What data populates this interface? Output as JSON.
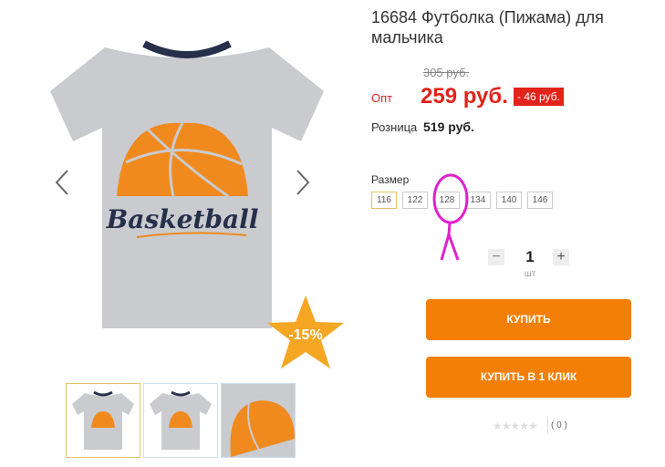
{
  "product": {
    "title": "16684 Футболка (Пижама) для мальчика",
    "old_price": "305 руб.",
    "opt_label": "Опт",
    "price": "259 руб.",
    "discount": "- 46 руб.",
    "retail_label": "Розница",
    "retail_price": "519 руб."
  },
  "gallery": {
    "badge": "-15%",
    "print_text": "Basketball"
  },
  "sizes": {
    "label": "Размер",
    "options": [
      "116",
      "122",
      "128",
      "134",
      "140",
      "146"
    ],
    "selected": "116"
  },
  "quantity": {
    "minus": "−",
    "value": "1",
    "plus": "+",
    "unit": "шт"
  },
  "actions": {
    "buy": "КУПИТЬ",
    "buy_one_click": "КУПИТЬ В 1 КЛИК"
  },
  "rating": {
    "stars": "★★★★★",
    "count": "( 0 )"
  },
  "colors": {
    "accent": "#f47f06",
    "price_red": "#e2231a",
    "annotation": "#e020d0",
    "shirt": "#c9cbcf",
    "collar": "#27304a",
    "ball": "#f08a1e"
  }
}
